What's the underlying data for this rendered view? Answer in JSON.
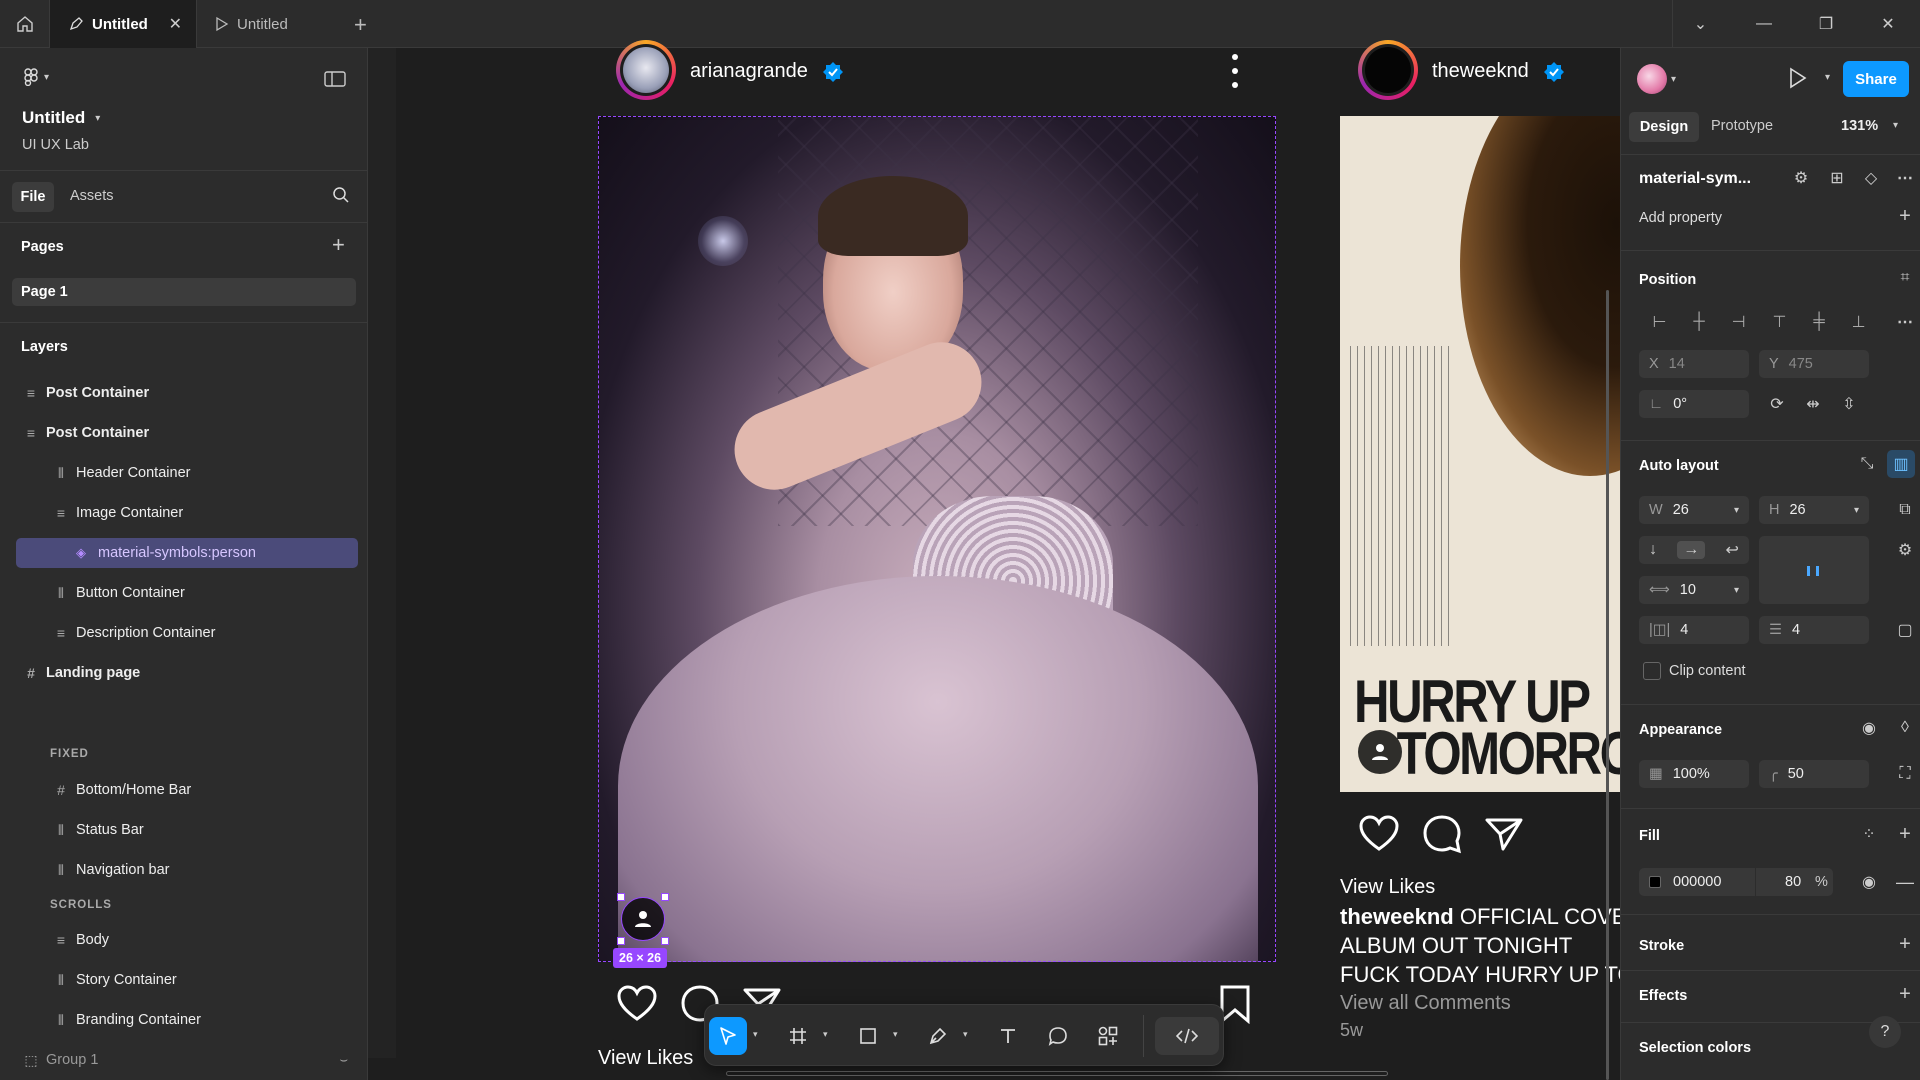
{
  "tabs": [
    {
      "label": "Untitled"
    },
    {
      "label": "Untitled"
    }
  ],
  "file": {
    "name": "Untitled",
    "team": "UI UX Lab"
  },
  "left_tabs": {
    "file": "File",
    "assets": "Assets"
  },
  "pages": {
    "title": "Pages",
    "items": [
      {
        "label": "Page 1"
      }
    ]
  },
  "layers": {
    "title": "Layers",
    "items": [
      {
        "label": "Post Container"
      },
      {
        "label": "Post Container"
      },
      {
        "label": "Header Container"
      },
      {
        "label": "Image Container"
      },
      {
        "label": "material-symbols:person"
      },
      {
        "label": "Button Container"
      },
      {
        "label": "Description Container"
      },
      {
        "label": "Landing page"
      },
      {
        "label": "FIXED"
      },
      {
        "label": "Bottom/Home Bar"
      },
      {
        "label": "Status Bar"
      },
      {
        "label": "Navigation bar"
      },
      {
        "label": "SCROLLS"
      },
      {
        "label": "Body"
      },
      {
        "label": "Story Container"
      },
      {
        "label": "Branding Container"
      },
      {
        "label": "Group 1"
      }
    ]
  },
  "canvas": {
    "post1": {
      "username": "arianagrande",
      "view_likes": "View Likes",
      "selection_size": "26 × 26"
    },
    "post2": {
      "username": "theweeknd",
      "poster_line1": "HURRY UP",
      "poster_line2": "TOMORRO",
      "view_likes": "View Likes",
      "caption_user": "theweeknd",
      "caption_l1": "OFFICIAL COVE",
      "caption_l2": "ALBUM OUT TONIGHT",
      "caption_l3": "FUCK TODAY HURRY UP TO",
      "view_comments": "View all Comments",
      "age": "5w"
    }
  },
  "right": {
    "share": "Share",
    "design_tab": "Design",
    "prototype_tab": "Prototype",
    "zoom": "131%",
    "component": "material-sym...",
    "add_property": "Add property",
    "position": {
      "title": "Position",
      "x_label": "X",
      "x": "14",
      "y_label": "Y",
      "y": "475",
      "rotation": "0°"
    },
    "auto_layout": {
      "title": "Auto layout",
      "w_label": "W",
      "w": "26",
      "h_label": "H",
      "h": "26",
      "gap": "10",
      "pad_h": "4",
      "pad_v": "4",
      "clip": "Clip content"
    },
    "appearance": {
      "title": "Appearance",
      "opacity": "100%",
      "radius": "50"
    },
    "fill": {
      "title": "Fill",
      "hex": "000000",
      "opacity": "80",
      "pct": "%"
    },
    "stroke": {
      "title": "Stroke"
    },
    "effects": {
      "title": "Effects"
    },
    "selection_colors": {
      "title": "Selection colors"
    },
    "help": "?"
  },
  "colors": {
    "accent": "#0d99ff",
    "selection": "#9747ff",
    "panel": "#2c2c2c",
    "canvas": "#1e1e1e"
  }
}
